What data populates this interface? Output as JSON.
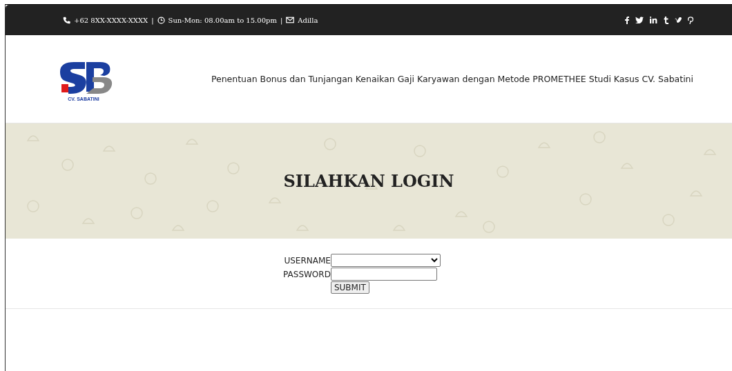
{
  "top_bar": {
    "phone": "+62 8XX-XXXX-XXXX",
    "separator_1": "|",
    "hours": "Sun-Mon: 08.00am to 15.00pm",
    "separator_2": "|",
    "email": "Adilla"
  },
  "header": {
    "logo_caption": "CV. SABATINI",
    "tagline": "Penentuan Bonus dan Tunjangan Kenaikan Gaji Karyawan dengan Metode PROMETHEE Studi Kasus CV. Sabatini"
  },
  "banner": {
    "title": "SILAHKAN LOGIN"
  },
  "form": {
    "fields": [
      {
        "kind": "select",
        "label": "USERNAME"
      },
      {
        "kind": "password",
        "label": "PASSWORD"
      }
    ],
    "submit": "SUBMIT"
  }
}
